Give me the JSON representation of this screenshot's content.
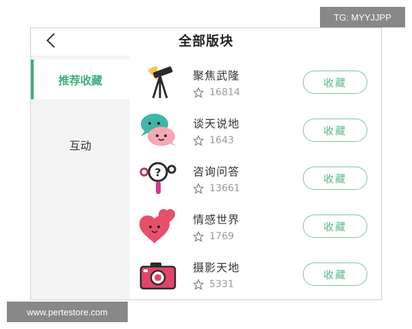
{
  "header": {
    "title": "全部版块"
  },
  "sidebar": {
    "items": [
      {
        "label": "推荐收藏",
        "active": true
      },
      {
        "label": "互动",
        "active": false
      }
    ]
  },
  "boards": [
    {
      "name": "聚焦武隆",
      "count": "16814",
      "button": "收藏",
      "icon": "telescope-icon"
    },
    {
      "name": "谈天说地",
      "count": "1643",
      "button": "收藏",
      "icon": "chat-faces-icon"
    },
    {
      "name": "咨询问答",
      "count": "13661",
      "button": "收藏",
      "icon": "question-magnifier-icon"
    },
    {
      "name": "情感世界",
      "count": "1769",
      "button": "收藏",
      "icon": "hearts-icon"
    },
    {
      "name": "摄影天地",
      "count": "5331",
      "button": "收藏",
      "icon": "camera-icon"
    }
  ],
  "watermarks": {
    "top": "TG: MYYJJPP",
    "bottom": "www.pertestore.com"
  },
  "colors": {
    "accent": "#3daf78",
    "button_border": "#7cc49f"
  }
}
